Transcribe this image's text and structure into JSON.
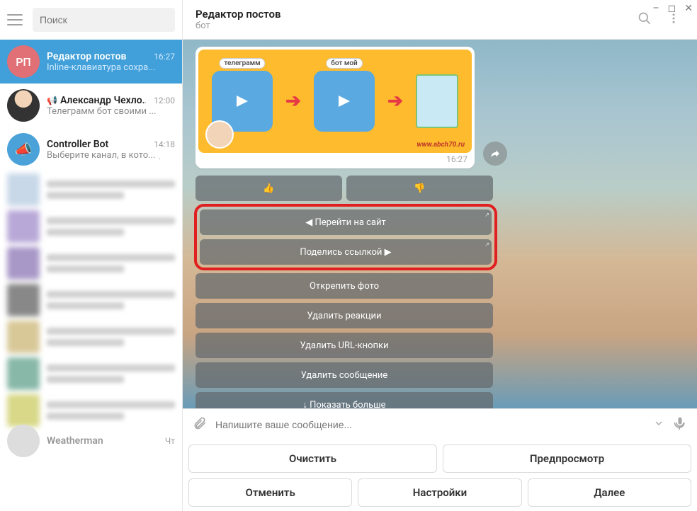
{
  "window": {
    "min": "–",
    "max": "◻",
    "close": "✕"
  },
  "search": {
    "placeholder": "Поиск"
  },
  "chats": [
    {
      "avatar_text": "РП",
      "name": "Редактор постов",
      "time": "16:27",
      "preview": "Inline-клавиатура сохра...",
      "selected": true,
      "avatar_class": "red"
    },
    {
      "avatar_text": "",
      "name": "Александр Чехло...",
      "time": "12:00",
      "preview": "Телеграмм бот своими ...",
      "pinned": true,
      "channel": true
    },
    {
      "avatar_text": "",
      "name": "Controller Bot",
      "time": "14:18",
      "preview": "Выберите канал, в кото...",
      "pinned": true,
      "controller": true
    },
    {
      "avatar_text": "",
      "name": "Weatherman",
      "time": "Чт"
    }
  ],
  "header": {
    "title": "Редактор постов",
    "subtitle": "бот"
  },
  "message": {
    "time": "16:27",
    "tile1": "телеграмм",
    "tile2": "бот мой",
    "url": "www.abch70.ru"
  },
  "inline": {
    "thumbs_up": "👍",
    "thumbs_down": "👎",
    "goto_site": "◀ Перейти на сайт",
    "share_link": "Поделись ссылкой ▶",
    "unpin_photo": "Открепить фото",
    "del_reactions": "Удалить реакции",
    "del_url": "Удалить URL-кнопки",
    "del_msg": "Удалить сообщение",
    "show_more": "↓ Показать больше"
  },
  "compose": {
    "placeholder": "Напишите ваше сообщение..."
  },
  "keyboard": {
    "clear": "Очистить",
    "preview": "Предпросмотр",
    "cancel": "Отменить",
    "settings": "Настройки",
    "next": "Далее"
  },
  "blurred_colors": [
    "#c8d8e8",
    "#b8a8d8",
    "#a898c8",
    "#888888",
    "#d8c898",
    "#88b8a8",
    "#d8d888",
    "#b8b8b8"
  ]
}
